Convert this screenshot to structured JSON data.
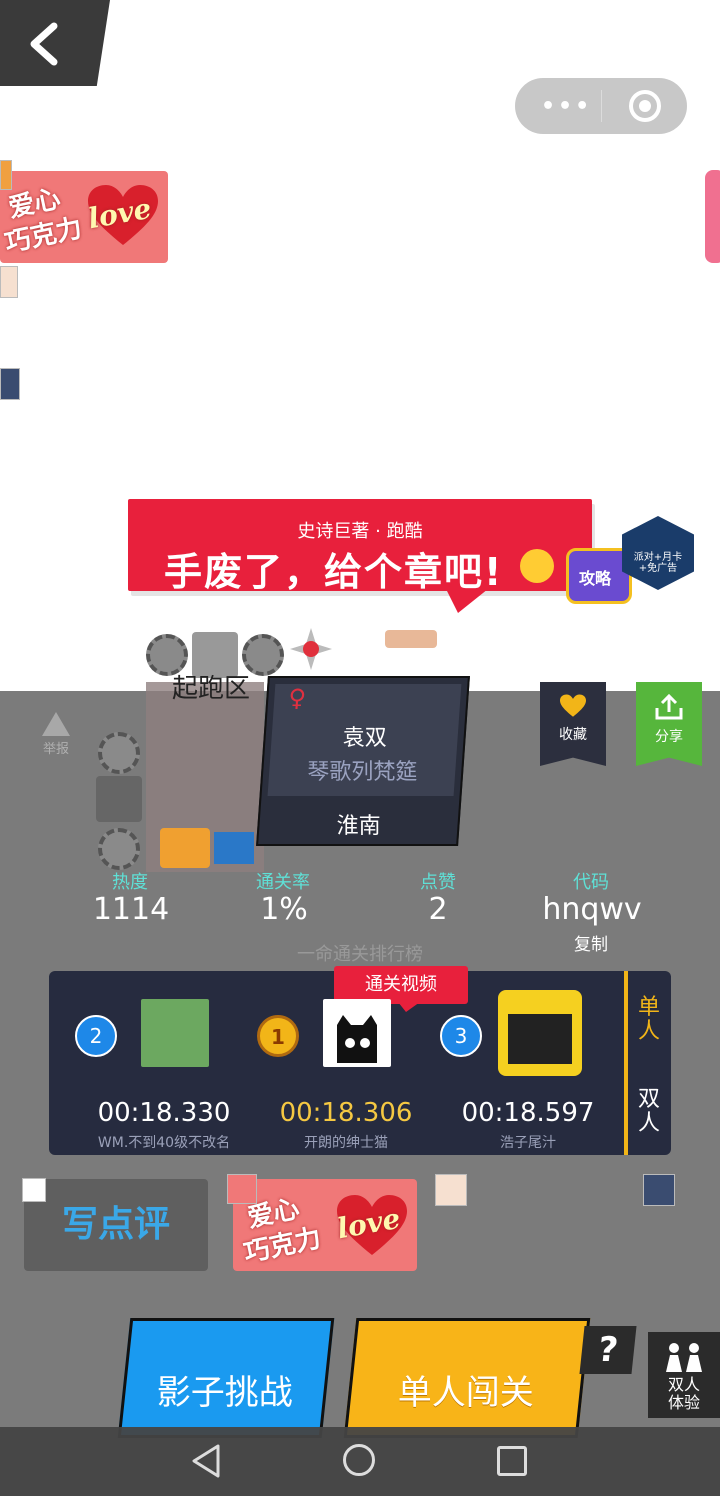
{
  "header": {
    "back_icon": "chevron-left-icon",
    "menu_dots": "•••",
    "close_icon": "target-circle-icon"
  },
  "ad_badge": {
    "line1": "爱心",
    "line2": "巧克力",
    "love": "love"
  },
  "banner": {
    "subtitle": "史诗巨著 · 跑酷",
    "title": "手废了，给个章吧!",
    "tv_label": "攻略",
    "hex_label": "派对+月卡\n+免广告"
  },
  "scene": {
    "start_zone": "起跑区"
  },
  "report": {
    "label": "举报"
  },
  "author": {
    "gender_symbol": "♀",
    "name": "袁双",
    "level": "琴歌列梵筵",
    "region": "淮南"
  },
  "favorite": {
    "label": "收藏"
  },
  "share": {
    "label": "分享"
  },
  "stats": [
    {
      "label": "热度",
      "value": "1114"
    },
    {
      "label": "通关率",
      "value": "1%"
    },
    {
      "label": "点赞",
      "value": "2"
    },
    {
      "label": "代码",
      "value": "hnqwv"
    }
  ],
  "copy_label": "复制",
  "leaderboard": {
    "title": "一命通关排行榜",
    "video_tag": "通关视频",
    "entries": [
      {
        "rank": "2",
        "time": "00:18.330",
        "name": "WM.不到40级不改名"
      },
      {
        "rank": "1",
        "time": "00:18.306",
        "name": "开朗的绅士猫"
      },
      {
        "rank": "3",
        "time": "00:18.597",
        "name": "浩子尾汁"
      }
    ],
    "tabs": {
      "single": "单人",
      "double": "双人"
    }
  },
  "review_button": "写点评",
  "shadow_button": "影子挑战",
  "solo_button": "单人闯关",
  "help_button": "?",
  "duo_button": {
    "line1": "双人",
    "line2": "体验"
  },
  "colors": {
    "red": "#e8203c",
    "gold": "#f2b518",
    "blue": "#1a9af0",
    "green": "#56b63c",
    "panel": "#7b7b7b"
  }
}
